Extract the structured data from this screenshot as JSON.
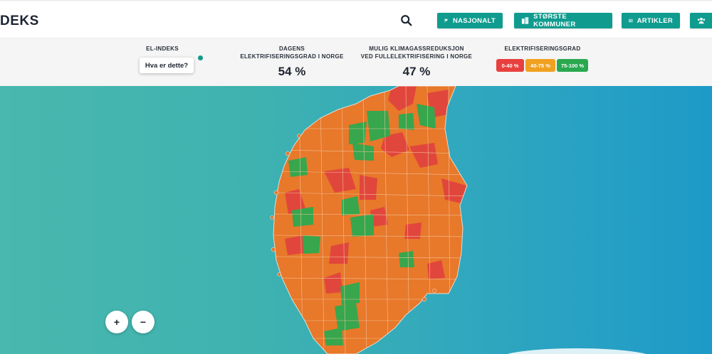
{
  "header": {
    "logo_text": "DEKS",
    "nav": [
      {
        "label": "NASJONALT",
        "icon": "flag-icon"
      },
      {
        "label": "STØRSTE KOMMUNER",
        "icon": "buildings-icon"
      },
      {
        "label": "ARTIKLER",
        "icon": "newspaper-icon"
      },
      {
        "label": "",
        "icon": "users-icon"
      }
    ]
  },
  "stats": {
    "elindeks": {
      "label": "EL-INDEKS",
      "button": "Hva er dette?"
    },
    "dagens": {
      "label_line1": "DAGENS",
      "label_line2": "ELEKTRIFISERINGSGRAD I NORGE",
      "value": "54 %"
    },
    "klima": {
      "label_line1": "MULIG KLIMAGASSREDUKSJON",
      "label_line2": "VED FULLELEKTRIFISERING I NORGE",
      "value": "47 %"
    },
    "legend": {
      "label": "ELEKTRIFISERINGSGRAD",
      "items": [
        {
          "label": "0-40 %",
          "color": "#e8403f"
        },
        {
          "label": "40-75 %",
          "color": "#f0a11f"
        },
        {
          "label": "75-100 %",
          "color": "#2aa84f"
        }
      ]
    }
  },
  "map": {
    "zoom_in": "+",
    "zoom_out": "−",
    "colors": {
      "orange": "#e8782a",
      "red": "#e1463c",
      "green": "#37a64d"
    }
  }
}
